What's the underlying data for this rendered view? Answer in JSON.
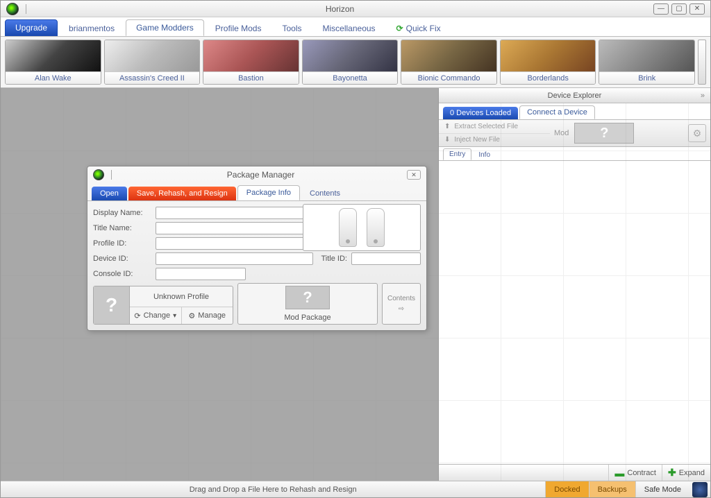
{
  "titlebar": {
    "title": "Horizon"
  },
  "mainTabs": {
    "upgrade": "Upgrade",
    "items": [
      "brianmentos",
      "Game Modders",
      "Profile Mods",
      "Tools",
      "Miscellaneous"
    ],
    "activeIndex": 1,
    "quickfix": "Quick Fix"
  },
  "games": [
    {
      "label": "Alan Wake"
    },
    {
      "label": "Assassin's Creed II"
    },
    {
      "label": "Bastion"
    },
    {
      "label": "Bayonetta"
    },
    {
      "label": "Bionic Commando"
    },
    {
      "label": "Borderlands"
    },
    {
      "label": "Brink"
    }
  ],
  "packageManager": {
    "title": "Package Manager",
    "tabs": {
      "open": "Open",
      "save": "Save, Rehash, and Resign",
      "info": "Package Info",
      "contents": "Contents"
    },
    "fields": {
      "displayName": "Display Name:",
      "titleName": "Title Name:",
      "profileId": "Profile ID:",
      "deviceId": "Device ID:",
      "consoleId": "Console ID:",
      "titleId": "Title ID:"
    },
    "profile": {
      "unknown": "Unknown Profile",
      "change": "Change",
      "manage": "Manage"
    },
    "modPackage": "Mod Package",
    "contentsBtn": "Contents"
  },
  "deviceExplorer": {
    "title": "Device Explorer",
    "tabs": {
      "loaded": "0 Devices Loaded",
      "connect": "Connect a Device"
    },
    "toolbar": {
      "extract": "Extract Selected File",
      "inject": "Inject New File",
      "mod": "Mod"
    },
    "subtabs": {
      "entry": "Entry",
      "info": "Info"
    },
    "footer": {
      "contract": "Contract",
      "expand": "Expand"
    }
  },
  "statusbar": {
    "text": "Drag and Drop a File Here to Rehash and Resign",
    "docked": "Docked",
    "backups": "Backups",
    "safeMode": "Safe Mode"
  }
}
